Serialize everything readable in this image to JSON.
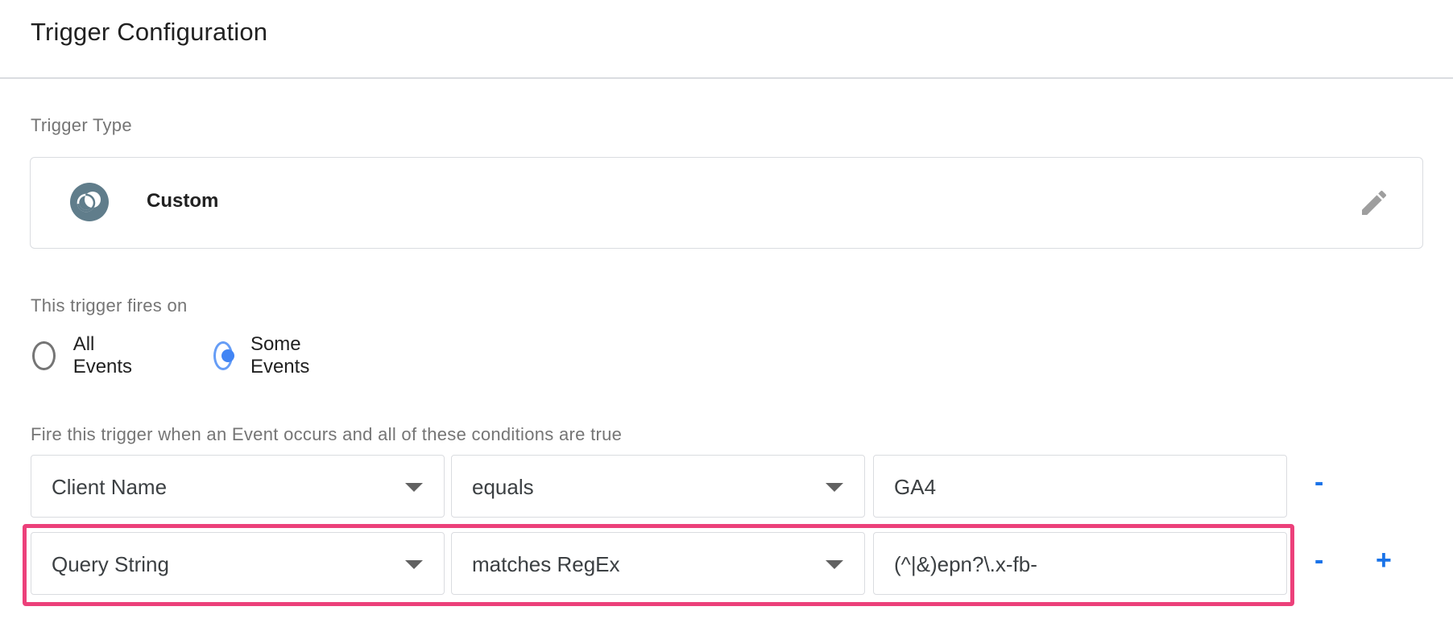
{
  "header": {
    "title": "Trigger Configuration"
  },
  "trigger_type": {
    "label": "Trigger Type",
    "name": "Custom",
    "icon": "custom-trigger-icon",
    "icon_color": "#607d8b",
    "edit_icon": "pencil-icon"
  },
  "fires_on": {
    "label": "This trigger fires on",
    "options": [
      {
        "label": "All Events",
        "selected": false
      },
      {
        "label": "Some Events",
        "selected": true
      }
    ]
  },
  "conditions": {
    "label": "Fire this trigger when an Event occurs and all of these conditions are true",
    "rows": [
      {
        "variable": "Client Name",
        "operator": "equals",
        "value": "GA4",
        "remove_label": "-",
        "add_label": ""
      },
      {
        "variable": "Query String",
        "operator": "matches RegEx",
        "value": "(^|&)epn?\\.x-fb-",
        "remove_label": "-",
        "add_label": "+"
      }
    ]
  },
  "colors": {
    "accent": "#1a73e8",
    "radio_selected": "#4285f4",
    "highlight": "#ec407a"
  }
}
